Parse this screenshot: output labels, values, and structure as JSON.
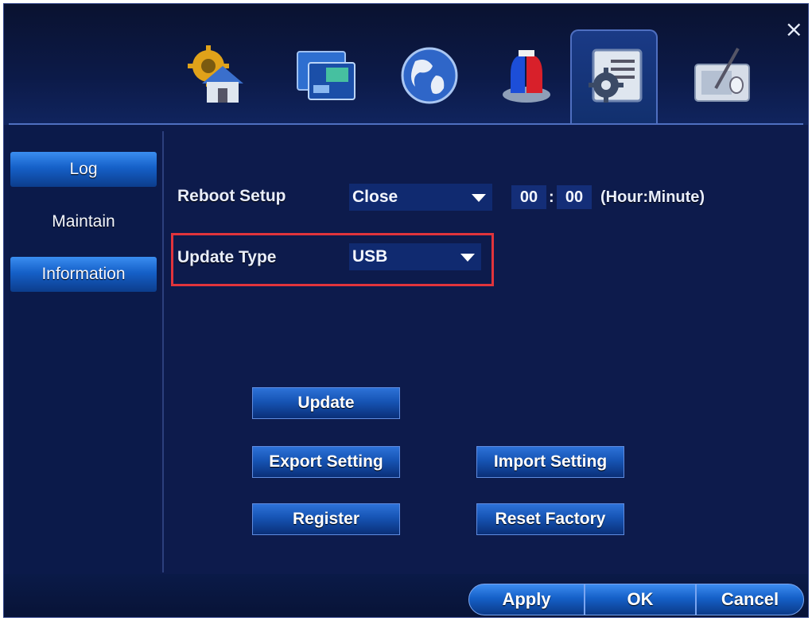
{
  "window": {
    "close_glyph": "×"
  },
  "tabs": [
    {
      "icon": "home-settings-icon"
    },
    {
      "icon": "display-icon"
    },
    {
      "icon": "network-globe-icon"
    },
    {
      "icon": "alarm-siren-icon"
    },
    {
      "icon": "system-settings-icon",
      "active": true
    },
    {
      "icon": "drawing-tablet-icon"
    }
  ],
  "sidebar": {
    "items": [
      {
        "label": "Log"
      },
      {
        "label": "Maintain"
      },
      {
        "label": "Information"
      }
    ]
  },
  "form": {
    "reboot_label": "Reboot Setup",
    "reboot_value": "Close",
    "hour": "00",
    "time_sep": ":",
    "minute": "00",
    "time_hint": "(Hour:Minute)",
    "update_type_label": "Update Type",
    "update_type_value": "USB"
  },
  "actions": {
    "update": "Update",
    "export": "Export Setting",
    "import": "Import Setting",
    "register": "Register",
    "reset": "Reset Factory"
  },
  "footer": {
    "apply": "Apply",
    "ok": "OK",
    "cancel": "Cancel"
  },
  "colors": {
    "background": "#0d1b4c",
    "accent": "#1560c8",
    "highlight": "#e0343c"
  }
}
